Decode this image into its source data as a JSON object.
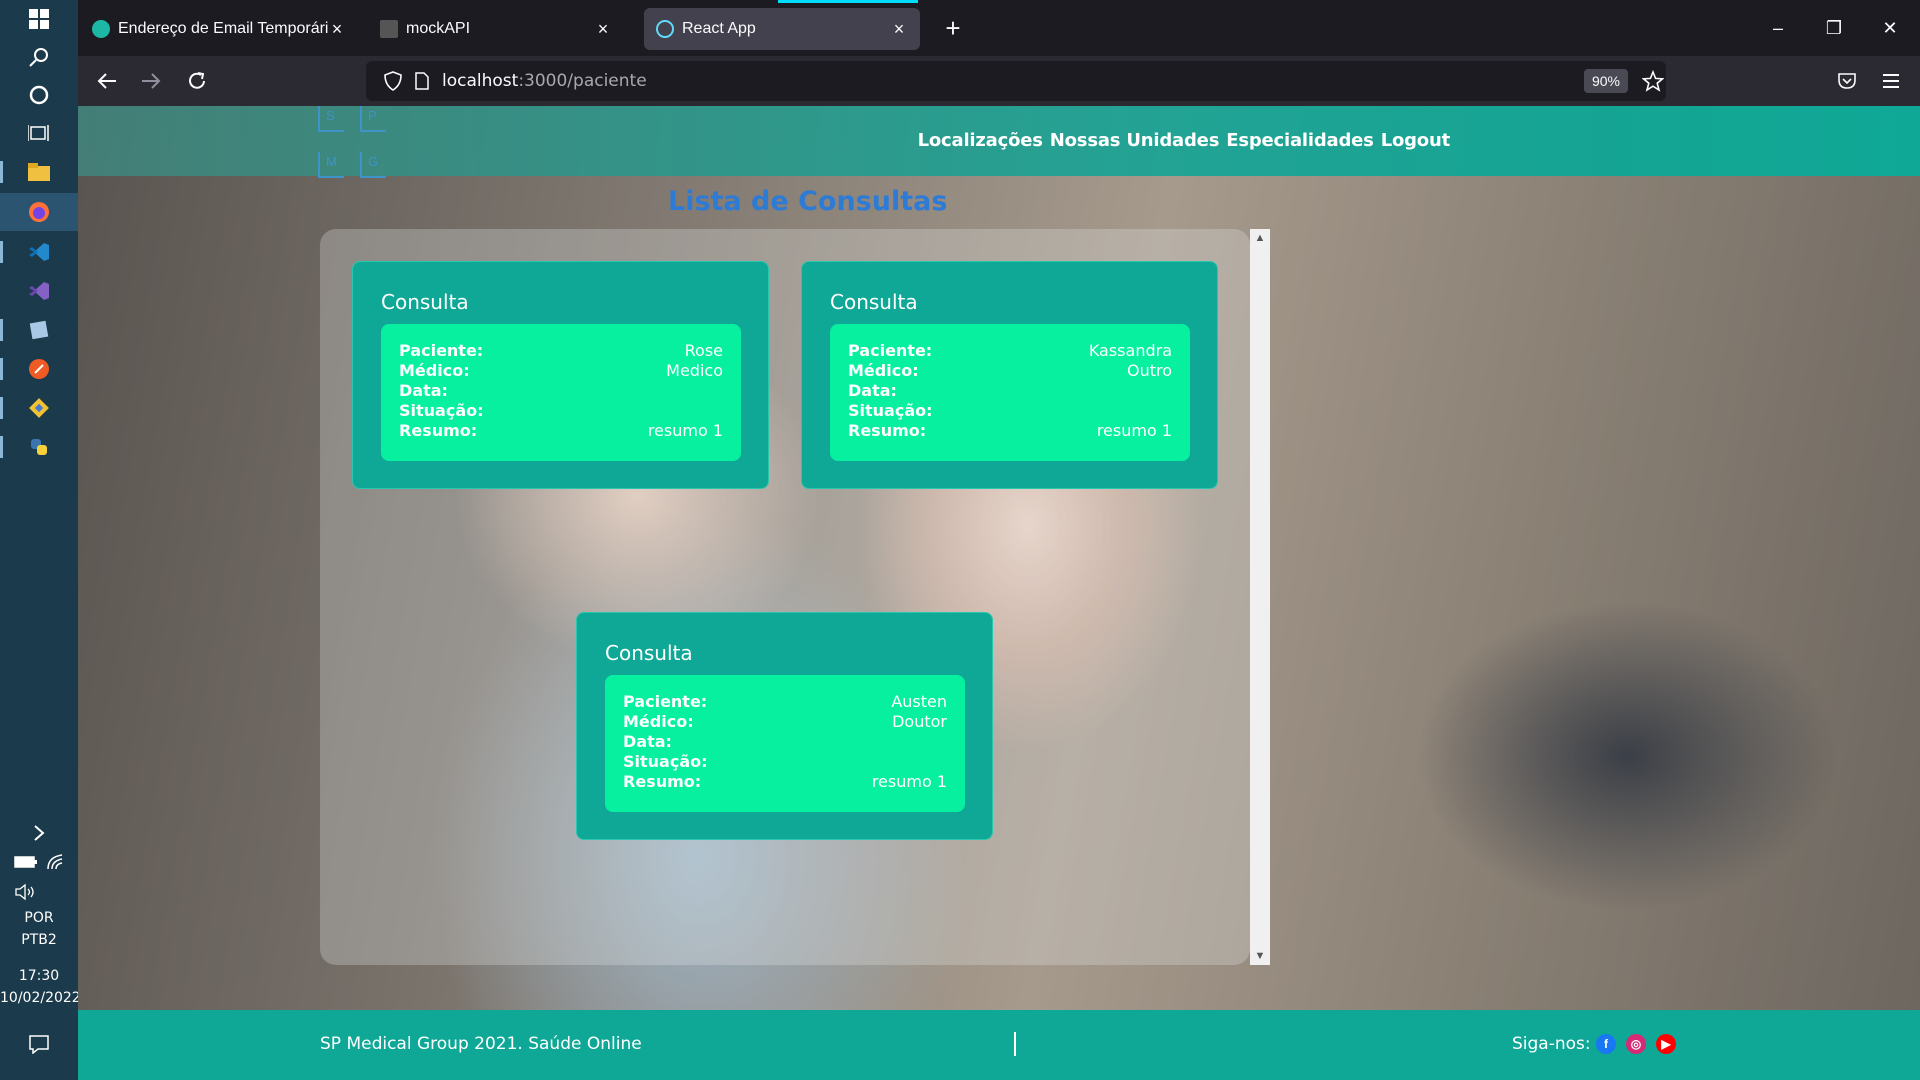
{
  "taskbar": {
    "icons": [
      "windows-start-icon",
      "search-icon",
      "cortana-icon",
      "task-view-icon",
      "file-explorer-icon",
      "firefox-icon",
      "vscode-icon",
      "visual-studio-icon",
      "app-icon",
      "postman-icon",
      "git-icon",
      "python-icon"
    ],
    "tray": {
      "lang1": "POR",
      "lang2": "PTB2",
      "time": "17:30",
      "date": "10/02/2022"
    }
  },
  "browser": {
    "tabs": [
      {
        "title": "Endereço de Email Temporário"
      },
      {
        "title": "mockAPI"
      },
      {
        "title": "React App"
      }
    ],
    "url_host": "localhost",
    "url_path": ":3000/paciente",
    "zoom": "90%"
  },
  "site": {
    "logo_letters": [
      "S",
      "P",
      "M",
      "G"
    ],
    "nav": [
      "Localizações",
      "Nossas Unidades",
      "Especialidades",
      "Logout"
    ],
    "page_title": "Lista de Consultas",
    "labels": {
      "paciente": "Paciente:",
      "medico": "Médico:",
      "data": "Data:",
      "situacao": "Situação:",
      "resumo": "Resumo:"
    },
    "consultas": [
      {
        "title": "Consulta",
        "paciente": "Rose",
        "medico": "Medico",
        "data": "",
        "situacao": "",
        "resumo": "resumo 1"
      },
      {
        "title": "Consulta",
        "paciente": "Kassandra",
        "medico": "Outro",
        "data": "",
        "situacao": "",
        "resumo": "resumo 1"
      },
      {
        "title": "Consulta",
        "paciente": "Austen",
        "medico": "Doutor",
        "data": "",
        "situacao": "",
        "resumo": "resumo 1"
      }
    ],
    "footer": {
      "text": "SP Medical Group 2021. Saúde Online",
      "follow": "Siga-nos:",
      "social": [
        "facebook-icon",
        "instagram-icon",
        "youtube-icon"
      ]
    },
    "colors": {
      "teal": "#0fa896",
      "mint": "#07f0a0",
      "title_blue": "#2e7bd6"
    }
  }
}
